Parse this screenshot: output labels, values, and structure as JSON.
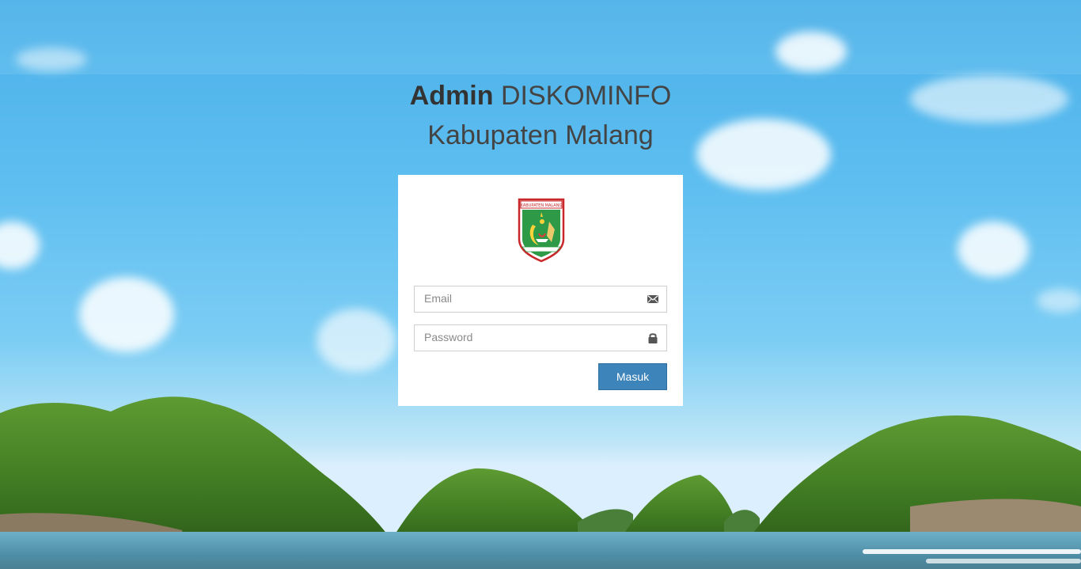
{
  "header": {
    "title_bold": "Admin",
    "title_rest": "DISKOMINFO",
    "subtitle": "Kabupaten Malang"
  },
  "logo": {
    "banner_text": "KABUPATEN MALANG"
  },
  "form": {
    "email_placeholder": "Email",
    "password_placeholder": "Password",
    "submit_label": "Masuk"
  },
  "colors": {
    "button": "#3c84ba",
    "panel": "#ffffff",
    "heading": "#333333"
  },
  "icons": {
    "email": "envelope-icon",
    "password": "lock-icon"
  }
}
